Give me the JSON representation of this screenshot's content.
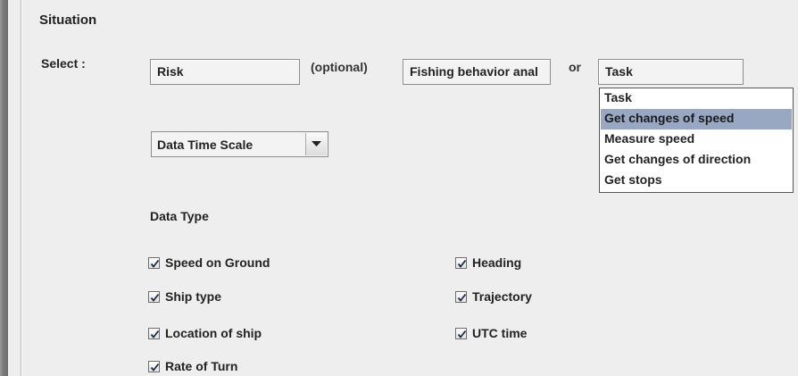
{
  "panel": {
    "title": "Situation"
  },
  "select_row": {
    "label": "Select :",
    "risk_value": "Risk",
    "optional_text": "(optional)",
    "fishing_value": "Fishing behavior anal",
    "or_text": "or",
    "task_value": "Task"
  },
  "task_dropdown": {
    "items": [
      {
        "label": "Task",
        "selected": false
      },
      {
        "label": "Get changes of speed",
        "selected": true
      },
      {
        "label": "Measure speed",
        "selected": false
      },
      {
        "label": "Get changes of direction",
        "selected": false
      },
      {
        "label": "Get stops",
        "selected": false
      }
    ]
  },
  "time_scale": {
    "value": "Data Time Scale"
  },
  "data_type": {
    "heading": "Data Type",
    "checkboxes": [
      {
        "label": "Speed on Ground",
        "checked": true
      },
      {
        "label": "Heading",
        "checked": true
      },
      {
        "label": "Ship type",
        "checked": true
      },
      {
        "label": "Trajectory",
        "checked": true
      },
      {
        "label": "Location of ship",
        "checked": true
      },
      {
        "label": "UTC time",
        "checked": true
      },
      {
        "label": "Rate of Turn",
        "checked": true
      }
    ]
  },
  "colors": {
    "panel_bg": "#eeeeee",
    "selection_bg": "#98a8c3"
  }
}
